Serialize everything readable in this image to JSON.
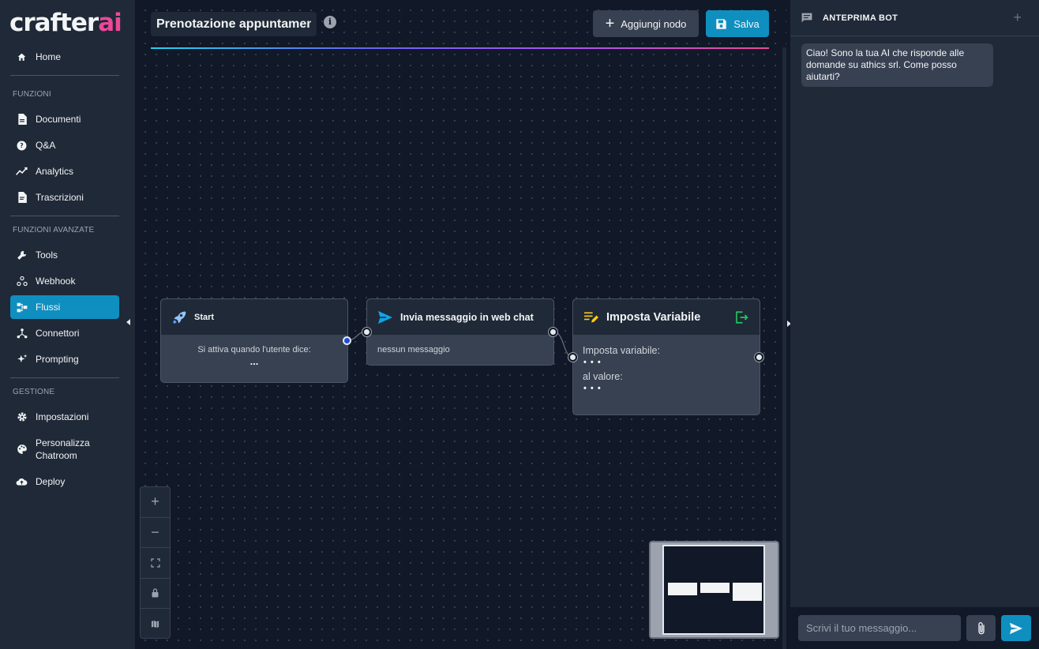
{
  "brand": {
    "logo_main": "crafter",
    "logo_accent": "ai"
  },
  "sidebar": {
    "home": "Home",
    "section_funzioni": "FUNZIONI",
    "documenti": "Documenti",
    "qa": "Q&A",
    "analytics": "Analytics",
    "trascrizioni": "Trascrizioni",
    "section_avanzate": "FUNZIONI AVANZATE",
    "tools": "Tools",
    "webhook": "Webhook",
    "flussi": "Flussi",
    "connettori": "Connettori",
    "prompting": "Prompting",
    "section_gestione": "GESTIONE",
    "impostazioni": "Impostazioni",
    "personalizza_line1": "Personalizza",
    "personalizza_line2": "Chatroom",
    "deploy": "Deploy"
  },
  "toolbar": {
    "flow_name": "Prenotazione appuntamen",
    "info_glyph": "i",
    "add_node_label": "Aggiungi nodo",
    "save_label": "Salva"
  },
  "nodes": {
    "start": {
      "title": "Start",
      "trigger_label": "Si attiva quando l'utente dice:",
      "trigger_value": "..."
    },
    "send": {
      "title": "Invia messaggio in web chat",
      "body": "nessun messaggio"
    },
    "setvar": {
      "title": "Imposta Variabile",
      "var_label": "Imposta variabile:",
      "var_value": "• • •",
      "value_label": "al valore:",
      "value_value": "• • •"
    }
  },
  "preview": {
    "title": "ANTEPRIMA BOT",
    "message": "Ciao! Sono la tua AI che risponde alle domande su athics srl. Come posso aiutarti?",
    "input_placeholder": "Scrivi il tuo messaggio..."
  },
  "colors": {
    "accent": "#0e8fbf",
    "bg": "#111827",
    "panel": "#1f2937",
    "node": "#374151"
  },
  "icons": {
    "home": "home-icon",
    "documenti": "document-icon",
    "qa": "help-circle-icon",
    "analytics": "chart-line-icon",
    "trascrizioni": "transcript-icon",
    "tools": "wrench-icon",
    "webhook": "webhook-icon",
    "flussi": "flow-icon",
    "connettori": "connector-icon",
    "prompting": "sparkle-icon",
    "impostazioni": "gear-icon",
    "personalizza": "palette-icon",
    "deploy": "cloud-upload-icon"
  }
}
